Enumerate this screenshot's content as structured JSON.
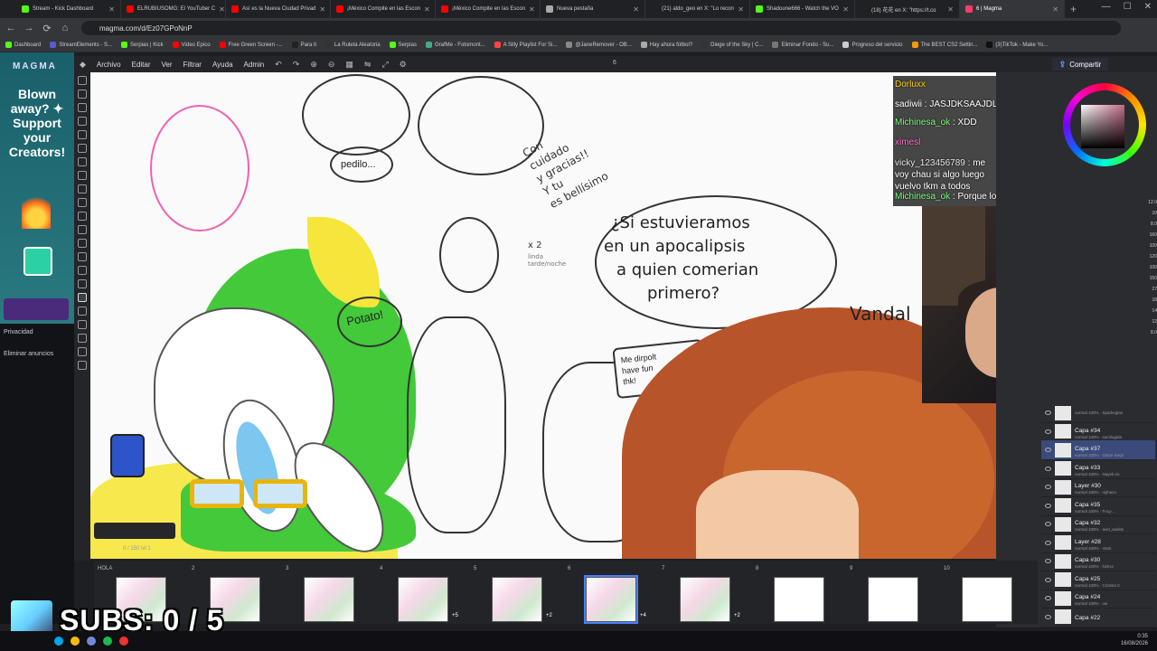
{
  "browser": {
    "tabs": [
      {
        "label": "Stream - Kick Dashboard",
        "color": "#53fc18"
      },
      {
        "label": "ELRUBIUSOMG: El YouTuber C",
        "color": "#ff0000"
      },
      {
        "label": "Así es la Nueva Ciudad Privad",
        "color": "#ff0000"
      },
      {
        "label": "¡México Compite en las Escon",
        "color": "#ff0000"
      },
      {
        "label": "¡México Compite en las Escon",
        "color": "#ff0000"
      },
      {
        "label": "Nueva pestaña",
        "color": "#aaaaaa"
      },
      {
        "label": "(21) aldo_geo en X: \"Lo recon",
        "color": "#222222"
      },
      {
        "label": "Shadoune666 - Watch the VO",
        "color": "#53fc18"
      },
      {
        "label": "(18) 花花 en X: \"https://t.co",
        "color": "#222222"
      },
      {
        "label": "6 | Magma",
        "color": "#ff3b6b",
        "active": true
      }
    ],
    "url": "magma.com/d/Ez07GPoNnP",
    "bookmarks": [
      "Dashboard",
      "StreamElements - S...",
      "Serpias | Kick",
      "Video Epico",
      "Free Green Screen -...",
      "Para ti",
      "La Ruleta Aleatoria",
      "Serpias",
      "GrafMe - Fotomont...",
      "A Silly Playlist For Si...",
      "@JaneRemover - OB...",
      "Hay ahora fútbol?",
      "Diege of the Sky | C...",
      "Eliminar Fondo - Su...",
      "Progreso del servicio",
      "The BEST CS2 Settin...",
      "(3)TikTok - Make Yo..."
    ]
  },
  "ad": {
    "logo": "MAGMA",
    "copy": "Blown away? ✦ Support your Creators!",
    "privacy": "Privacidad",
    "remove": "Eliminar anuncios"
  },
  "app": {
    "menu": [
      "Archivo",
      "Editar",
      "Ver",
      "Filtrar",
      "Ayuda",
      "Admin"
    ],
    "page": "6",
    "share": "Compartir",
    "zoom": "0 / 150 lvl 1"
  },
  "canvas": {
    "speech": [
      "¿Si estuvieramos",
      "en un apocalipsis",
      "a quien comerian",
      "primero?"
    ],
    "potato": "Potato!",
    "pedilo": "pedilo...",
    "note": [
      "Me dirpolt",
      "have fun",
      "thk!"
    ],
    "cursive": [
      "Con",
      "cuidado",
      "y gracias!!",
      "Y tu",
      "es bellísimo"
    ],
    "vandal": "Vandal",
    "x2": "x 2",
    "linda": "linda tarde/noche"
  },
  "chat": [
    {
      "user": "Dorluxx",
      "msg": "",
      "color": "#ffd400"
    },
    {
      "user": "sadiwii",
      "msg": "JASJDKSAAJDL",
      "color": "#ffffff"
    },
    {
      "user": "Michinesa_ok",
      "msg": "XDD",
      "color": "#78ff7a"
    },
    {
      "user": "ximesl",
      "msg": "",
      "color": "#ff6ec7"
    },
    {
      "user": "vicky_123456789",
      "msg": "me voy chau si algo luego vuelvo tkm a todos",
      "color": "#e6e6e6"
    },
    {
      "user": "Michinesa_ok",
      "msg": "Porque lo eres",
      "color": "#78ff7a"
    }
  ],
  "layers": [
    {
      "name": "",
      "sub": "normal 100% · Sparkeglas"
    },
    {
      "name": "Capa #34",
      "sub": "normal 100% · sacrilagida"
    },
    {
      "name": "Capa #37",
      "sub": "normal 100% · Glaze Serpi",
      "selected": true
    },
    {
      "name": "Capa #33",
      "sub": "normal 100% · Nayeli An"
    },
    {
      "name": "Layer #30",
      "sub": "normal 100% · mjihazo"
    },
    {
      "name": "Capa #35",
      "sub": "normal 100% · Frog-..."
    },
    {
      "name": "Capa #32",
      "sub": "normal 100% · axel_asaltis"
    },
    {
      "name": "Layer #28",
      "sub": "normal 100% · Vanti"
    },
    {
      "name": "Capa #30",
      "sub": "normal 100% · NiiXcz"
    },
    {
      "name": "Capa #25",
      "sub": "normal 100% · Cristina C"
    },
    {
      "name": "Capa #24",
      "sub": "normal 100% · ow"
    },
    {
      "name": "Capa #22",
      "sub": ""
    }
  ],
  "scale": [
    "12.0",
    "10",
    "8.0",
    "160",
    "100",
    "120",
    "100",
    "150",
    "27",
    "18",
    "14",
    "12",
    "8.0"
  ],
  "frames": [
    {
      "label": "HOLA",
      "count": ""
    },
    {
      "label": "2",
      "count": ""
    },
    {
      "label": "3",
      "count": ""
    },
    {
      "label": "4",
      "count": "+5"
    },
    {
      "label": "5",
      "count": "+2"
    },
    {
      "label": "6",
      "count": "+4",
      "current": true
    },
    {
      "label": "7",
      "count": "+2"
    },
    {
      "label": "8",
      "count": ""
    },
    {
      "label": "9",
      "count": ""
    },
    {
      "label": "10",
      "count": ""
    }
  ],
  "overlay": {
    "subs": "SUBS: 0 / 5"
  },
  "clock": {
    "time": "0:35",
    "date": "16/08/2026"
  }
}
